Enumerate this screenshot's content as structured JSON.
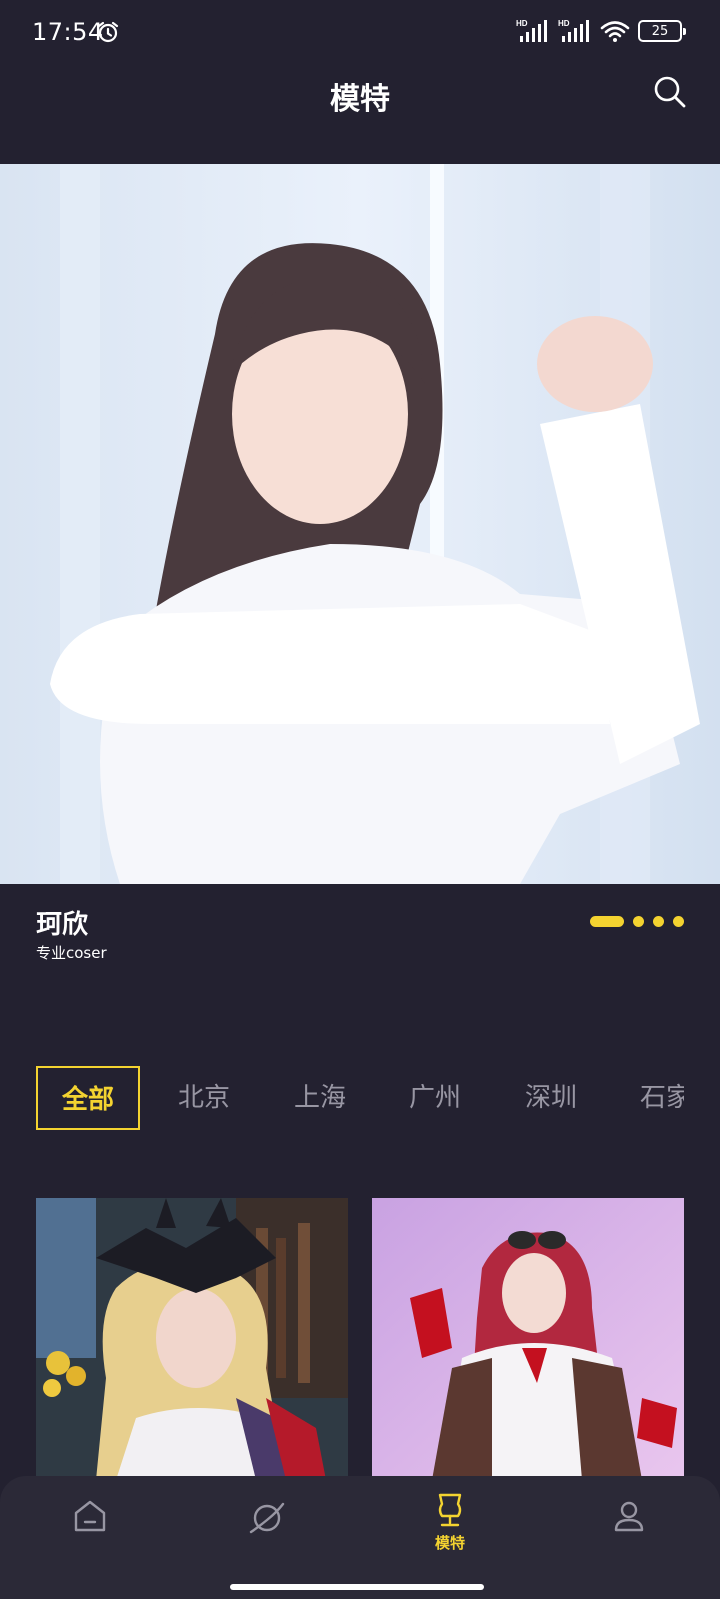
{
  "status_bar": {
    "time": "17:54",
    "battery": "25",
    "icons": [
      "alarm-icon",
      "signal-icon",
      "signal-icon",
      "wifi-icon",
      "battery-icon"
    ]
  },
  "header": {
    "title": "模特",
    "search_icon": "search-icon"
  },
  "banner": {
    "name": "珂欣",
    "subtitle": "专业coser",
    "slide_count": 4,
    "active_slide": 1
  },
  "city_tabs": {
    "items": [
      "全部",
      "北京",
      "上海",
      "广州",
      "深圳",
      "石家"
    ],
    "active": "全部"
  },
  "cards": [
    "model-card-1",
    "model-card-2"
  ],
  "bottom_nav": {
    "items": [
      {
        "icon": "home-icon",
        "label": ""
      },
      {
        "icon": "planet-icon",
        "label": ""
      },
      {
        "icon": "dress-form-icon",
        "label": "模特"
      },
      {
        "icon": "user-icon",
        "label": ""
      }
    ],
    "active_index": 2
  },
  "colors": {
    "background": "#232130",
    "accent": "#f4d330",
    "tab_inactive": "#9896a3",
    "nav_background": "#2b2937"
  }
}
